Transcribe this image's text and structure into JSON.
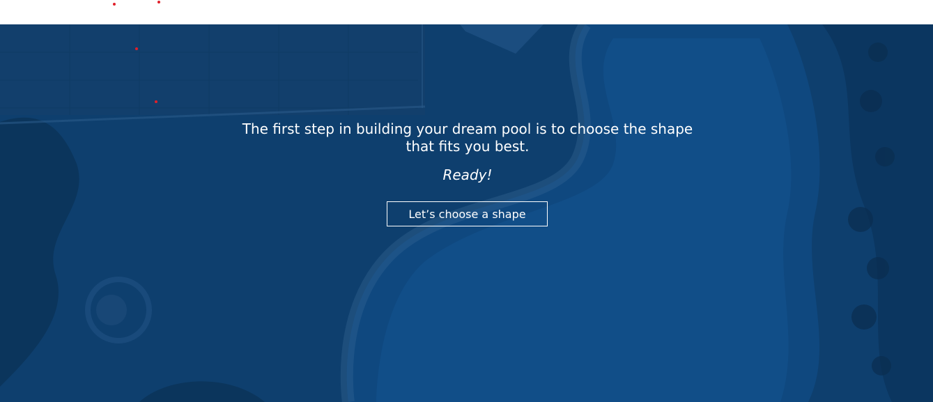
{
  "hero": {
    "headline": "The first step in building your dream pool is to choose the shape that fits you best.",
    "subtitle": "Ready!",
    "cta_label": "Let’s choose a shape"
  },
  "colors": {
    "overlay": "#0e3f6e",
    "accent_dots": "#e0202a",
    "text": "#ffffff"
  }
}
